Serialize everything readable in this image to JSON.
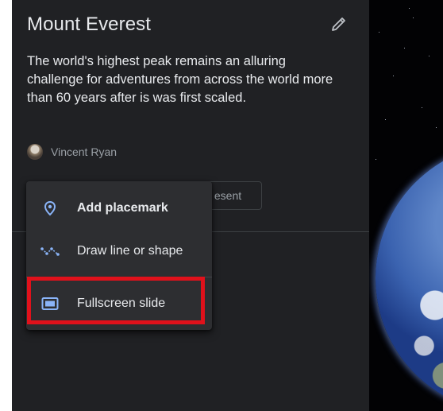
{
  "project": {
    "title": "Mount Everest",
    "description": "The world's highest peak remains an alluring challenge for adventures from across the world more than 60 years after is was first scaled.",
    "author": "Vincent Ryan"
  },
  "toolbar": {
    "present_label": "esent"
  },
  "menu": {
    "items": [
      {
        "label": "Add placemark",
        "icon": "placemark-icon"
      },
      {
        "label": "Draw line or shape",
        "icon": "line-shape-icon"
      },
      {
        "label": "Fullscreen slide",
        "icon": "fullscreen-slide-icon"
      }
    ]
  },
  "colors": {
    "panel": "#202124",
    "menu": "#2d2e31",
    "accent": "#8ab4f8",
    "highlight": "#e0111b",
    "text": "#e8eaed",
    "muted": "#9aa0a6"
  }
}
